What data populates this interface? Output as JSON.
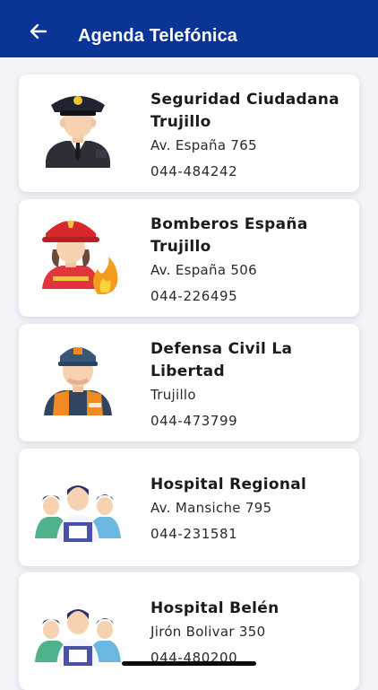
{
  "header": {
    "title": "Agenda Telefónica",
    "back_icon": "arrow-left-icon",
    "background": "#0a3596"
  },
  "contacts": [
    {
      "name": "Seguridad Ciudadana Trujillo",
      "address": "Av. España 765",
      "phone": "044-484242",
      "icon": "police-officer-icon"
    },
    {
      "name": "Bomberos España Trujillo",
      "address": "Av. España 506",
      "phone": "044-226495",
      "icon": "firefighter-icon"
    },
    {
      "name": "Defensa Civil La Libertad",
      "address": "Trujillo",
      "phone": "044-473799",
      "icon": "civil-defense-worker-icon"
    },
    {
      "name": "Hospital Regional",
      "address": "Av. Mansiche 795",
      "phone": "044-231581",
      "icon": "medical-staff-icon"
    },
    {
      "name": "Hospital Belén",
      "address": "Jirón Bolivar 350",
      "phone": "044-480200",
      "icon": "medical-staff-icon"
    }
  ]
}
